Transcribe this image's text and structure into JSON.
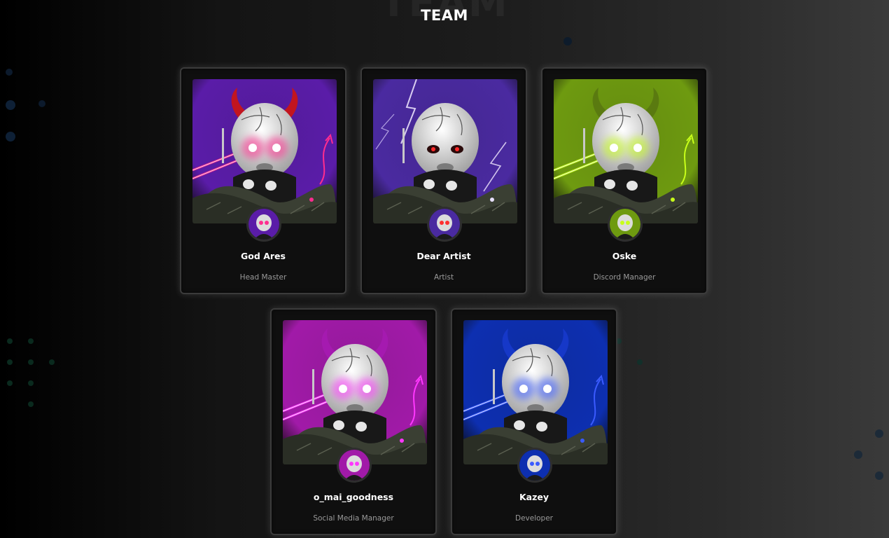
{
  "section": {
    "title": "TEAM"
  },
  "members": [
    {
      "name": "God Ares",
      "role": "Head Master",
      "bg": "#5a1ca8",
      "accent": "#ff2d8f",
      "horn": "#c2151f",
      "style": "laser"
    },
    {
      "name": "Dear Artist",
      "role": "Artist",
      "bg": "#4a2aa0",
      "accent": "#e8e0ff",
      "horn": "none",
      "style": "lightning"
    },
    {
      "name": "Oske",
      "role": "Discord Manager",
      "bg": "#6e9a10",
      "accent": "#c8ff1a",
      "horn": "#5a7a10",
      "style": "laser"
    },
    {
      "name": "o_mai_goodness",
      "role": "Social Media Manager",
      "bg": "#a11aa8",
      "accent": "#ff37ff",
      "horn": "#a51ab0",
      "style": "laser"
    },
    {
      "name": "Kazey",
      "role": "Developer",
      "bg": "#0d2fb0",
      "accent": "#3a5bff",
      "horn": "#1638c8",
      "style": "laser"
    }
  ]
}
